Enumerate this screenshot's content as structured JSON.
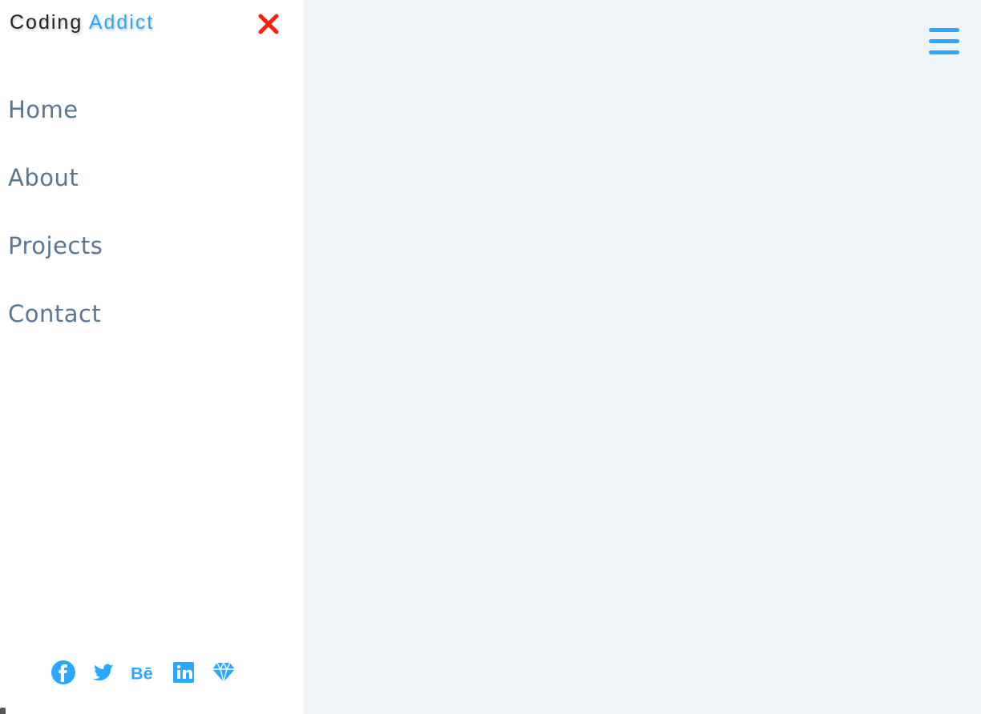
{
  "brand": {
    "primary": "Coding",
    "accent": "Addict"
  },
  "colors": {
    "accent": "#2aa7ff",
    "close": "#ff1f0f",
    "nav_text": "#5a7691",
    "sidebar_bg": "#ffffff",
    "main_bg": "#eef4f7"
  },
  "sidebar": {
    "close_icon": "close-icon",
    "nav_items": [
      {
        "label": "Home"
      },
      {
        "label": "About"
      },
      {
        "label": "Projects"
      },
      {
        "label": "Contact"
      }
    ],
    "social_links": [
      {
        "icon": "facebook-icon"
      },
      {
        "icon": "twitter-icon"
      },
      {
        "icon": "behance-icon"
      },
      {
        "icon": "linkedin-icon"
      },
      {
        "icon": "sketch-icon"
      }
    ]
  },
  "main": {
    "menu_icon": "hamburger-menu-icon"
  }
}
